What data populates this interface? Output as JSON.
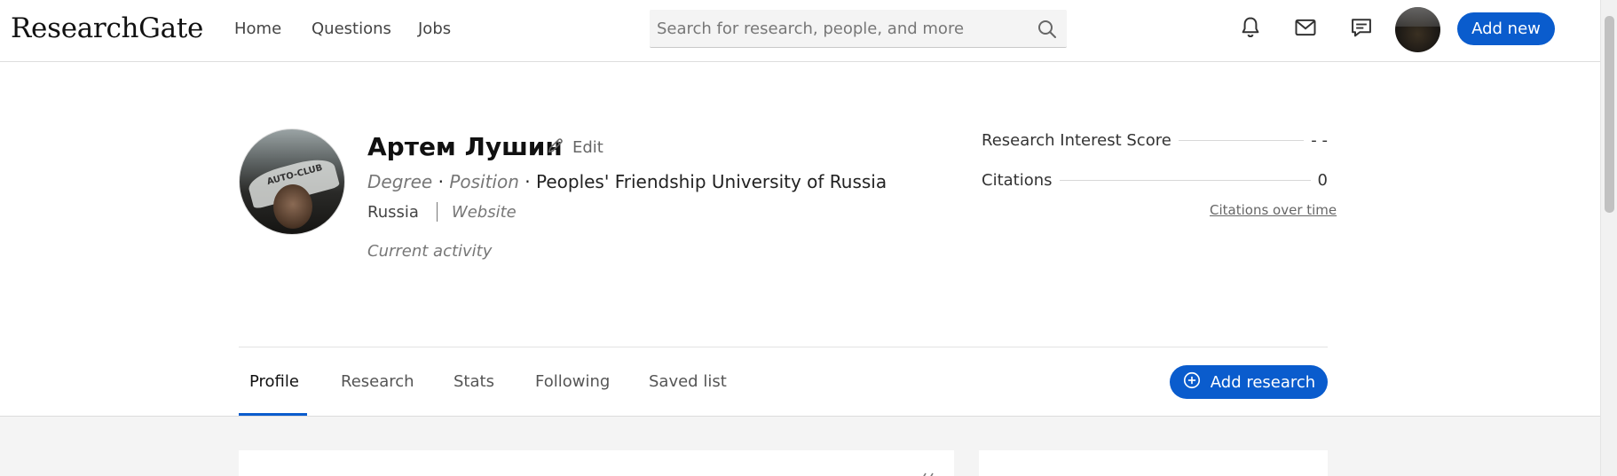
{
  "header": {
    "logo": "ResearchGate",
    "nav": [
      "Home",
      "Questions",
      "Jobs"
    ],
    "search_placeholder": "Search for research, people, and more",
    "icons": [
      "bell-icon",
      "mail-icon",
      "chat-icon",
      "search-icon"
    ],
    "add_new": "Add new"
  },
  "profile": {
    "name": "Артем Лушин",
    "edit": "Edit",
    "degree": "Degree",
    "position": "Position",
    "separator": "·",
    "institution": "Peoples' Friendship University of Russia",
    "country": "Russia",
    "website": "Website",
    "current_activity": "Current activity",
    "avatar_caption": "AUTO-CLUB"
  },
  "stats": {
    "research_interest_label": "Research Interest Score",
    "research_interest_value": "- -",
    "citations_label": "Citations",
    "citations_value": "0",
    "citations_over_time": "Citations over time"
  },
  "tabs": {
    "items": [
      "Profile",
      "Research",
      "Stats",
      "Following",
      "Saved list"
    ],
    "active": "Profile",
    "add_research": "Add research"
  },
  "colors": {
    "accent": "#0a5ccd",
    "background_lower": "#f4f4f4"
  }
}
